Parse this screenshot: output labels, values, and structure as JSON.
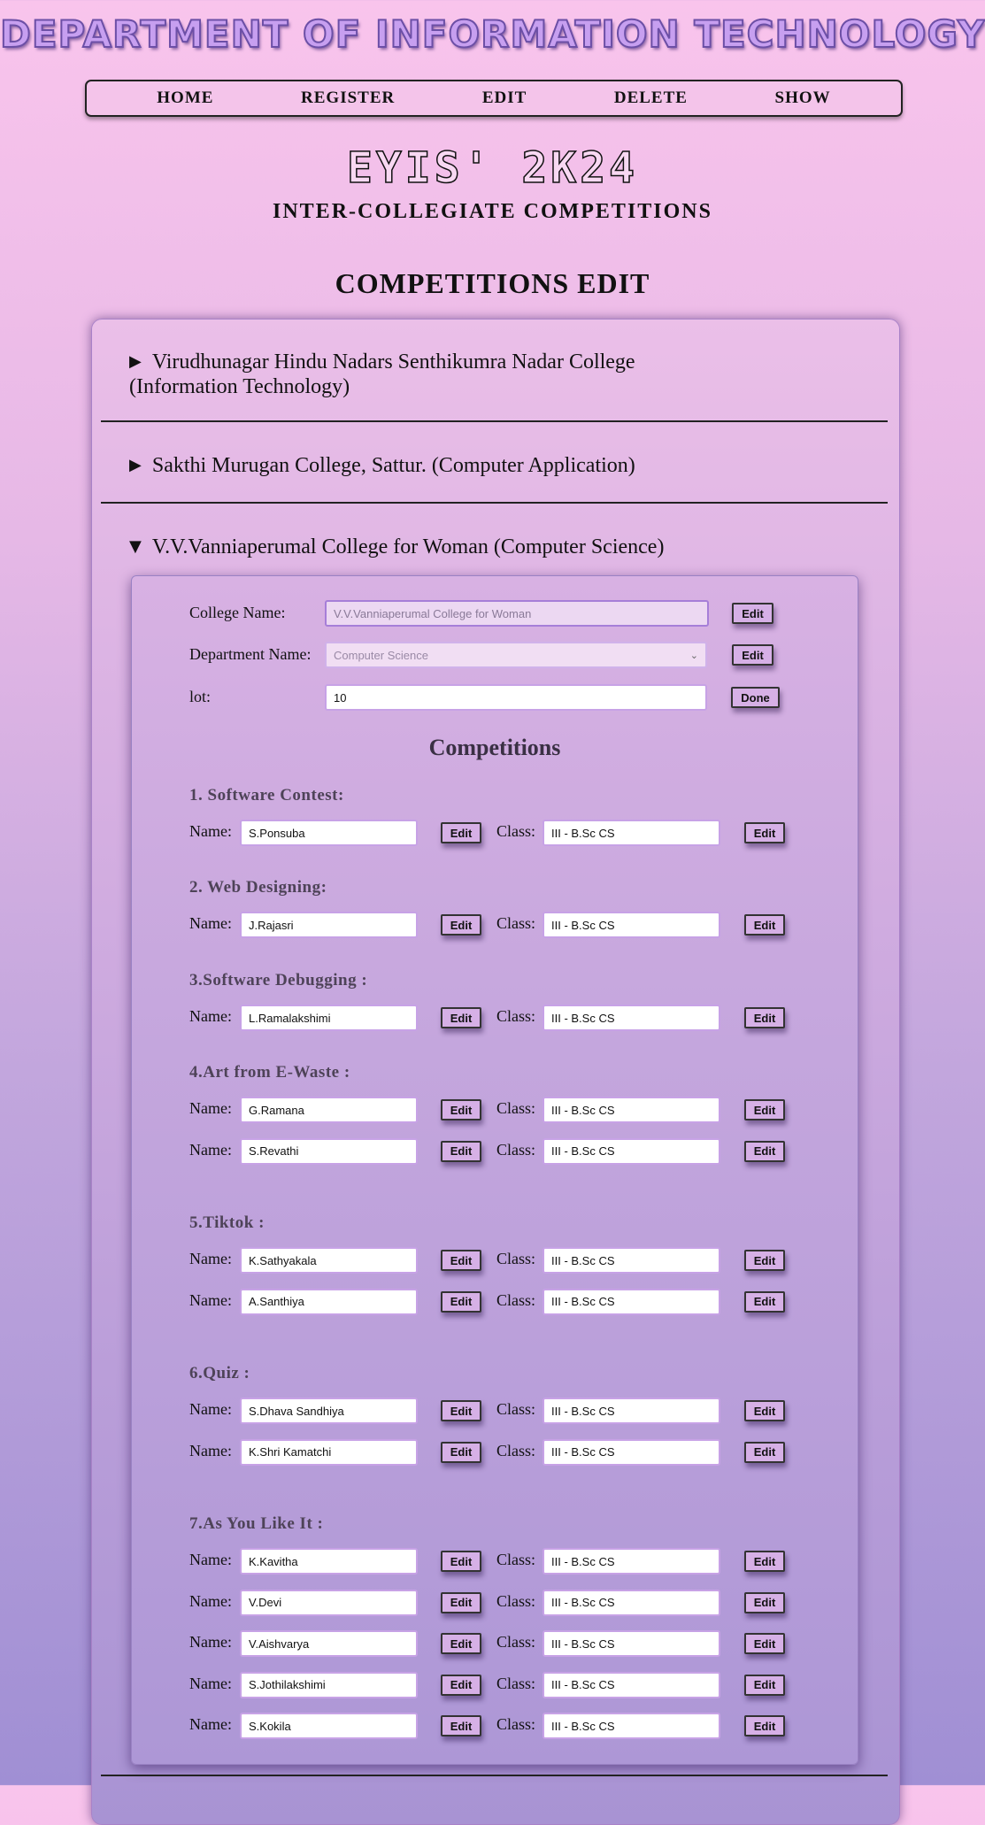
{
  "department_title": "DEPARTMENT OF INFORMATION TECHNOLOGY",
  "nav": [
    "HOME",
    "REGISTER",
    "EDIT",
    "DELETE",
    "SHOW"
  ],
  "event_title": "EYIS' 2K24",
  "event_subtitle": "INTER-COLLEGIATE COMPETITIONS",
  "page_heading": "COMPETITIONS EDIT",
  "colleges": [
    {
      "line1": "Virudhunagar Hindu Nadars Senthikumra Nadar College",
      "line2": "(Information Technology)",
      "expanded": false
    },
    {
      "line1": "Sakthi Murugan College, Sattur. (Computer Application)",
      "expanded": false
    },
    {
      "line1": "V.V.Vanniaperumal College for Woman (Computer Science)",
      "expanded": true
    }
  ],
  "form": {
    "college_name_label": "College Name:",
    "college_name_value": "V.V.Vanniaperumal College for Woman",
    "department_label": "Department Name:",
    "department_value": "Computer Science",
    "lot_label": "lot:",
    "lot_value": "10",
    "edit_label": "Edit",
    "done_label": "Done"
  },
  "competitions_heading": "Competitions",
  "name_label": "Name:",
  "class_label": "Class:",
  "edit_label": "Edit",
  "sections": [
    {
      "title": "1. Software Contest:",
      "entries": [
        {
          "name": "S.Ponsuba",
          "class": "III - B.Sc CS"
        }
      ]
    },
    {
      "title": "2. Web Designing:",
      "entries": [
        {
          "name": "J.Rajasri",
          "class": "III - B.Sc CS"
        }
      ]
    },
    {
      "title": "3.Software Debugging :",
      "entries": [
        {
          "name": "L.Ramalakshimi",
          "class": "III - B.Sc CS"
        }
      ]
    },
    {
      "title": "4.Art from E-Waste :",
      "entries": [
        {
          "name": "G.Ramana",
          "class": "III - B.Sc CS"
        },
        {
          "name": "S.Revathi",
          "class": "III - B.Sc CS"
        }
      ]
    },
    {
      "title": "5.Tiktok :",
      "entries": [
        {
          "name": "K.Sathyakala",
          "class": "III - B.Sc CS"
        },
        {
          "name": "A.Santhiya",
          "class": "III - B.Sc CS"
        }
      ]
    },
    {
      "title": "6.Quiz :",
      "entries": [
        {
          "name": "S.Dhava Sandhiya",
          "class": "III - B.Sc CS"
        },
        {
          "name": "K.Shri Kamatchi",
          "class": "III - B.Sc CS"
        }
      ]
    },
    {
      "title": "7.As You Like It :",
      "entries": [
        {
          "name": "K.Kavitha",
          "class": "III - B.Sc CS"
        },
        {
          "name": "V.Devi",
          "class": "III - B.Sc CS"
        },
        {
          "name": "V.Aishvarya",
          "class": "III - B.Sc CS"
        },
        {
          "name": "S.Jothilakshimi",
          "class": "III - B.Sc CS"
        },
        {
          "name": "S.Kokila",
          "class": "III - B.Sc CS"
        }
      ]
    }
  ]
}
